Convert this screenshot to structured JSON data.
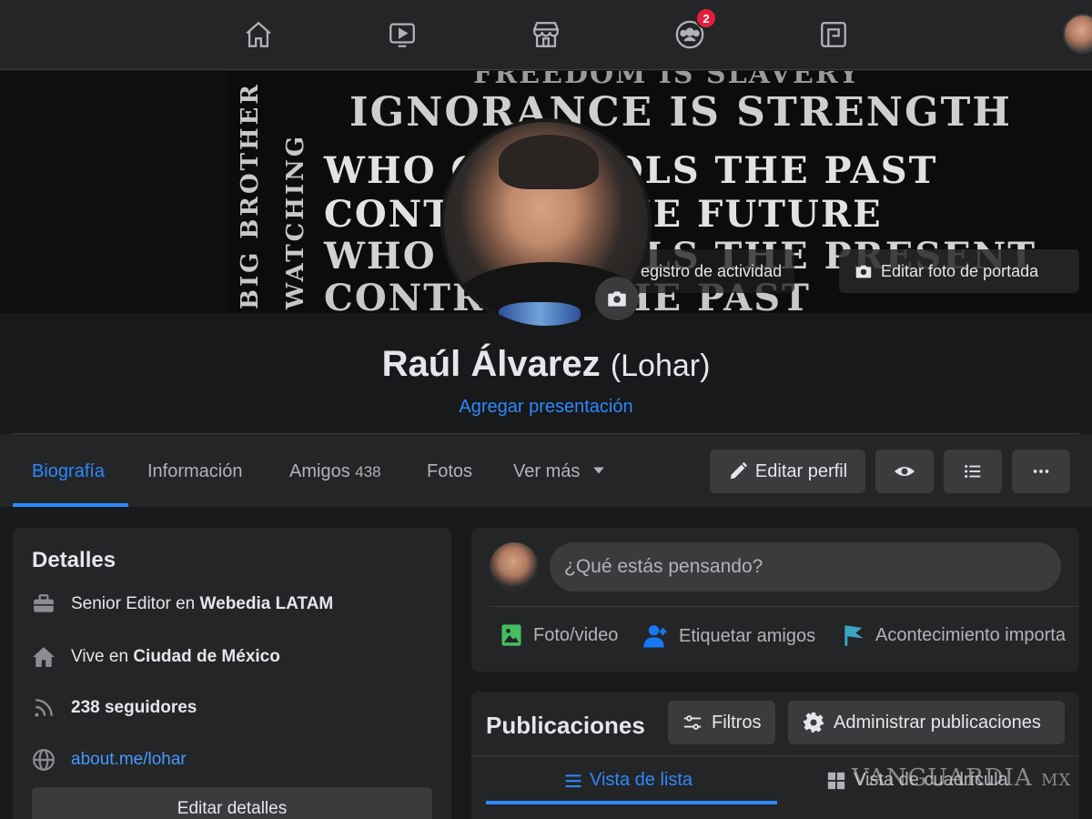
{
  "nav": {
    "notifications_badge": "2"
  },
  "cover": {
    "lines": [
      "FREEDOM IS SLAVERY",
      "IGNORANCE IS STRENGTH",
      "WHO CONTROLS THE PAST",
      "CONTROLS THE FUTURE",
      "WHO CONTROLS THE PRESENT",
      "CONTROLS THE PAST"
    ],
    "vertical_1": "BIG BROTHER",
    "vertical_2": "WATCHING",
    "activity_button": "egistro de actividad",
    "edit_cover_button": "Editar foto de portada"
  },
  "profile": {
    "name": "Raúl Álvarez",
    "alt_name": "(Lohar)",
    "add_bio": "Agregar presentación"
  },
  "tabs": [
    {
      "label": "Biografía"
    },
    {
      "label": "Información"
    },
    {
      "label": "Amigos",
      "count": "438"
    },
    {
      "label": "Fotos"
    },
    {
      "label": "Ver más"
    }
  ],
  "actions": {
    "edit_profile": "Editar perfil"
  },
  "details": {
    "title": "Detalles",
    "work_prefix": "Senior Editor en ",
    "work_company": "Webedia LATAM",
    "lives_prefix": "Vive en ",
    "lives_city": "Ciudad de México",
    "followers": "238 seguidores",
    "website": "about.me/lohar",
    "edit_button": "Editar detalles"
  },
  "composer": {
    "placeholder": "¿Qué estás pensando?",
    "photo_video": "Foto/video",
    "tag_friends": "Etiquetar amigos",
    "life_event": "Acontecimiento importa"
  },
  "posts": {
    "title": "Publicaciones",
    "filters": "Filtros",
    "manage": "Administrar publicaciones",
    "list_view": "Vista de lista",
    "grid_view": "Vista de cuadrícula"
  },
  "watermark": {
    "brand": "VANGUARDIA",
    "suffix": "MX"
  },
  "colors": {
    "background": "#18191a",
    "surface": "#242526",
    "button": "#3a3b3c",
    "accent": "#2d88ff",
    "badge": "#e41e3f"
  }
}
